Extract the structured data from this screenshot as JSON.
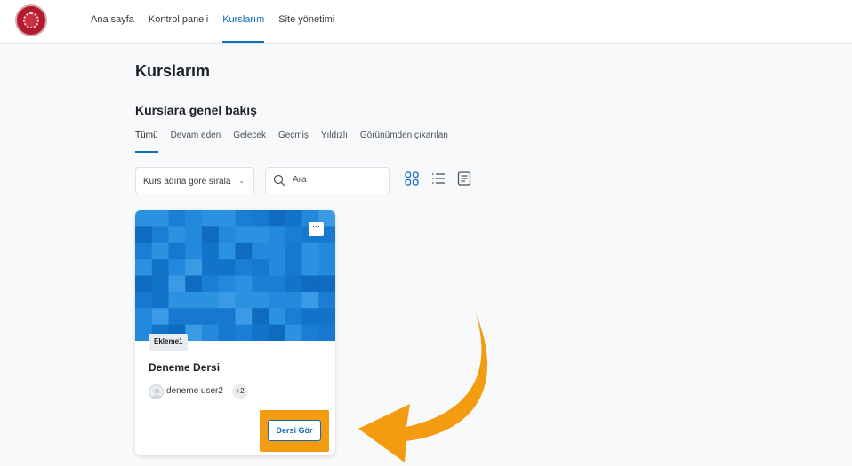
{
  "nav": {
    "links": [
      "Ana sayfa",
      "Kontrol paneli",
      "Kurslarım",
      "Site yönetimi"
    ],
    "active": "Kurslarım"
  },
  "page": {
    "title": "Kurslarım"
  },
  "overview": {
    "title": "Kurslara genel bakış",
    "tabs": [
      "Tümü",
      "Devam eden",
      "Gelecek",
      "Geçmiş",
      "Yıldızlı",
      "Görünümden çıkarılan"
    ],
    "active_tab": "Tümü"
  },
  "controls": {
    "sort_label": "Kurs adına göre sırala",
    "search_placeholder": "Ara",
    "views": [
      "grid-icon",
      "list-icon",
      "summary-icon"
    ]
  },
  "course": {
    "category": "Ekleme1",
    "name": "Deneme Dersi",
    "teacher": "deneme user2",
    "more_count": "+2",
    "view_button": "Dersi Gör",
    "menu": "···"
  },
  "colors": {
    "accent": "#0f6cbf",
    "highlight": "#f39c12",
    "card_image": "#1a7fd4"
  }
}
